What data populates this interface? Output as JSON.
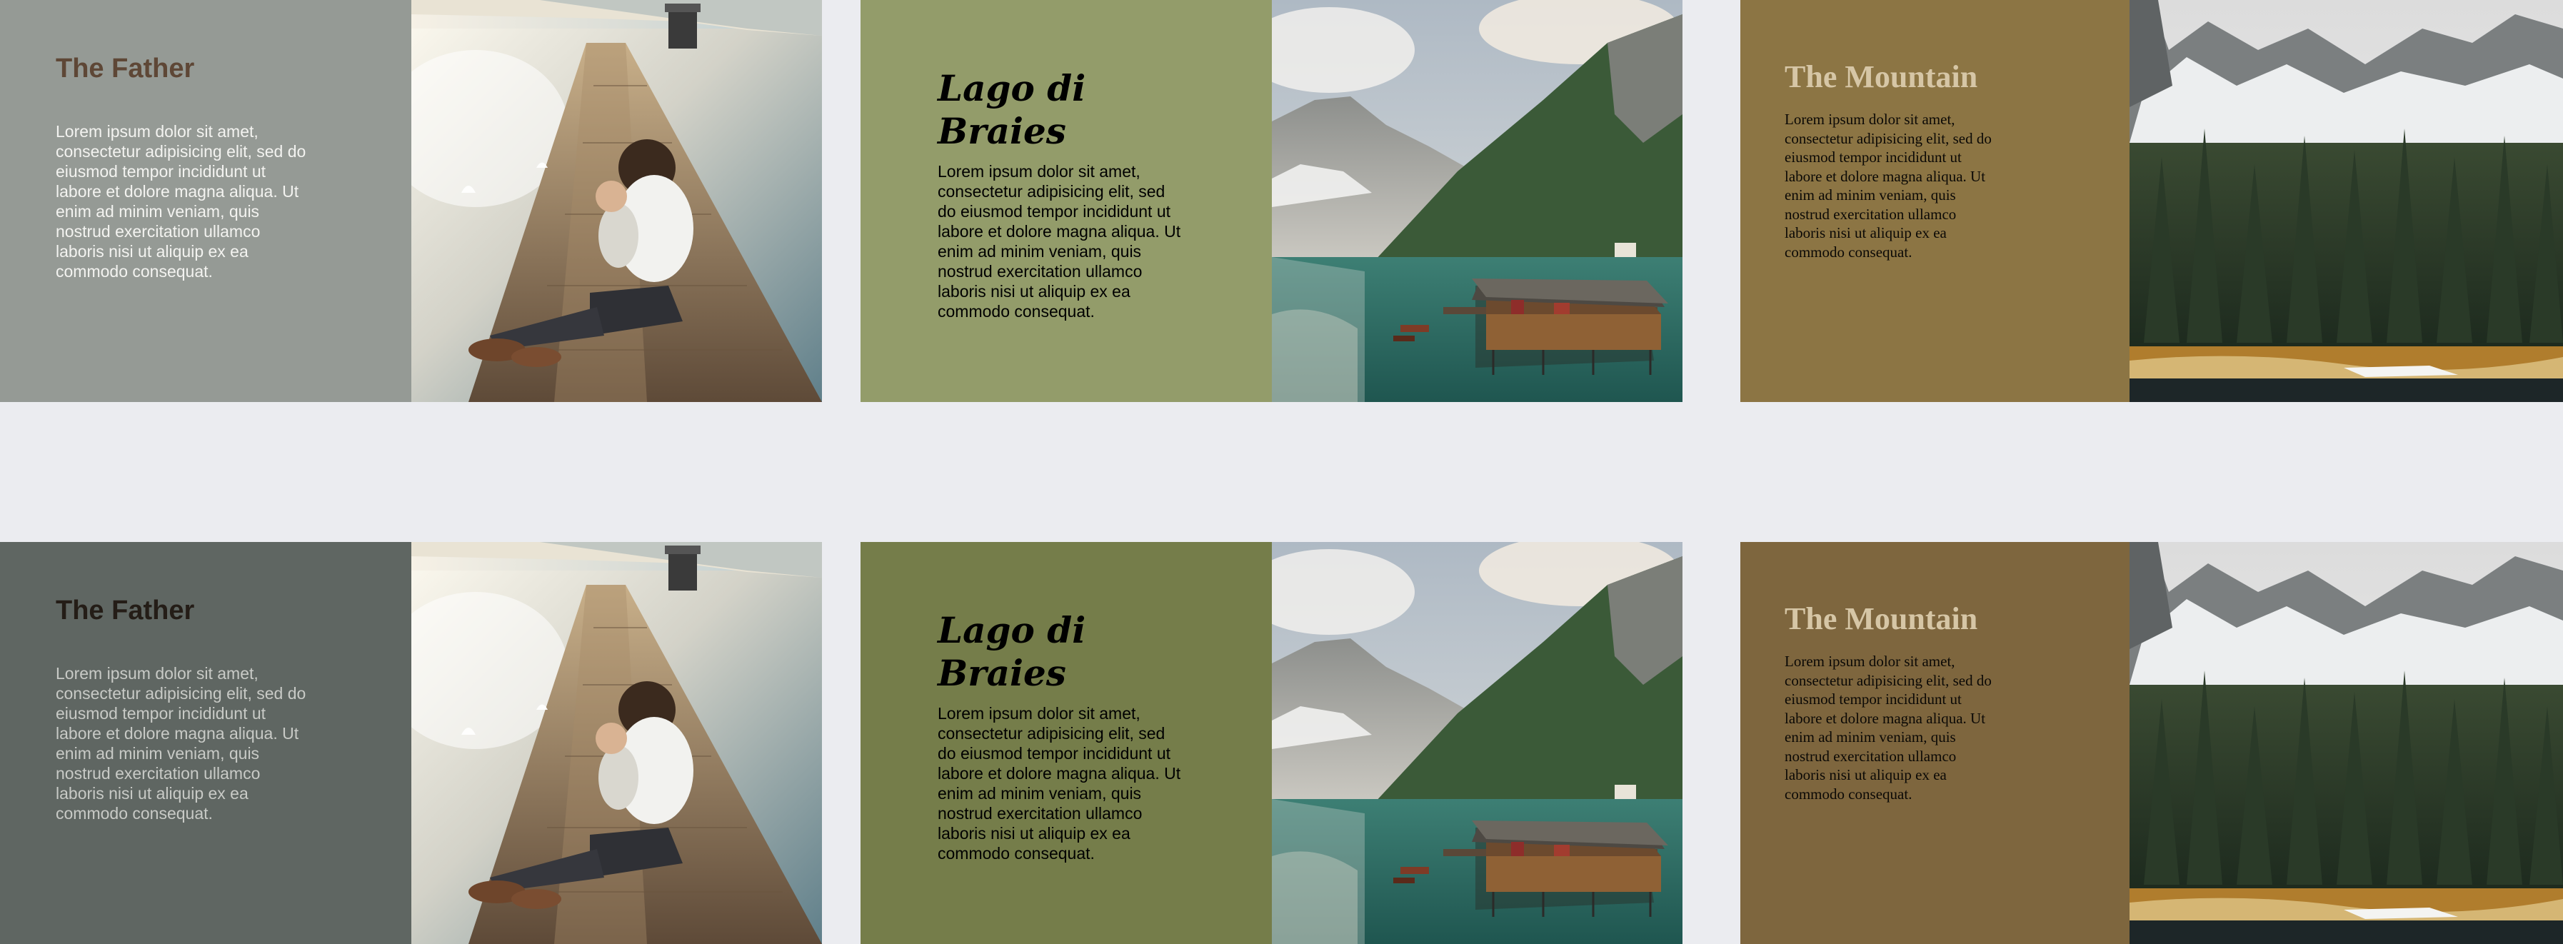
{
  "cards": [
    {
      "title": "The Father",
      "body": "Lorem ipsum dolor sit amet, consectetur adipisicing elit, sed do eiusmod tempor incididunt ut labore et dolore magna aliqua. Ut enim ad minim veniam, quis nostrud exercitation ullamco laboris nisi ut aliquip ex ea commodo consequat.",
      "image": "father-on-pier-photo"
    },
    {
      "title": "Lago di Braies",
      "body": "Lorem ipsum dolor sit amet, consectetur adipisicing elit, sed do eiusmod tempor incididunt ut labore et dolore magna aliqua. Ut enim ad minim veniam, quis nostrud exercitation ullamco laboris nisi ut aliquip ex ea commodo consequat.",
      "image": "lake-boathouse-photo"
    },
    {
      "title": "The Mountain",
      "body": "Lorem ipsum dolor sit amet, consectetur adipisicing elit, sed do eiusmod tempor incididunt ut labore et dolore magna aliqua. Ut enim ad minim veniam, quis nostrud exercitation ullamco laboris nisi ut aliquip ex ea commodo consequat.",
      "image": "mountain-forest-photo"
    }
  ],
  "colors": {
    "page_background": "#ebecf0",
    "row1": {
      "father": "#959a95",
      "lago": "#939c6a",
      "mountain": "#8c7544"
    },
    "row2": {
      "father": "#5f6662",
      "lago": "#757d4a",
      "mountain": "#7e663e"
    }
  }
}
